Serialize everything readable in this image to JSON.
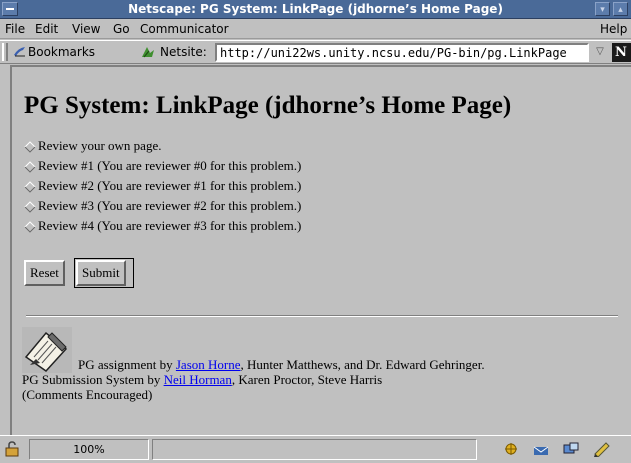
{
  "window": {
    "title": "Netscape: PG System: LinkPage (jdhorne’s Home Page)"
  },
  "menu": {
    "items": [
      "File",
      "Edit",
      "View",
      "Go",
      "Communicator"
    ],
    "help": "Help"
  },
  "location": {
    "bookmarks_label": "Bookmarks",
    "netsite_label": "Netsite:",
    "url": "http://uni22ws.unity.ncsu.edu/PG-bin/pg.LinkPage"
  },
  "page": {
    "title": "PG System: LinkPage (jdhorne’s Home Page)",
    "options": [
      "Review your own page.",
      "Review #1 (You are reviewer #0 for this problem.)",
      "Review #2 (You are reviewer #1 for this problem.)",
      "Review #3 (You are reviewer #2 for this problem.)",
      "Review #4 (You are reviewer #3 for this problem.)"
    ],
    "reset_label": "Reset",
    "submit_label": "Submit",
    "footer": {
      "line1_prefix": "PG assignment by",
      "line1_link": "Jason Horne",
      "line1_suffix": ", Hunter Matthews, and Dr. Edward Gehringer.",
      "line2_prefix": "PG Submission System by",
      "line2_link": "Neil Horman",
      "line2_suffix": ", Karen Proctor, Steve Harris",
      "line3": "(Comments Encouraged)"
    }
  },
  "status": {
    "zoom": "100%"
  },
  "colors": {
    "titlebar": "#4a6a98",
    "background": "#c0c0c0",
    "link": "#0000ee"
  }
}
